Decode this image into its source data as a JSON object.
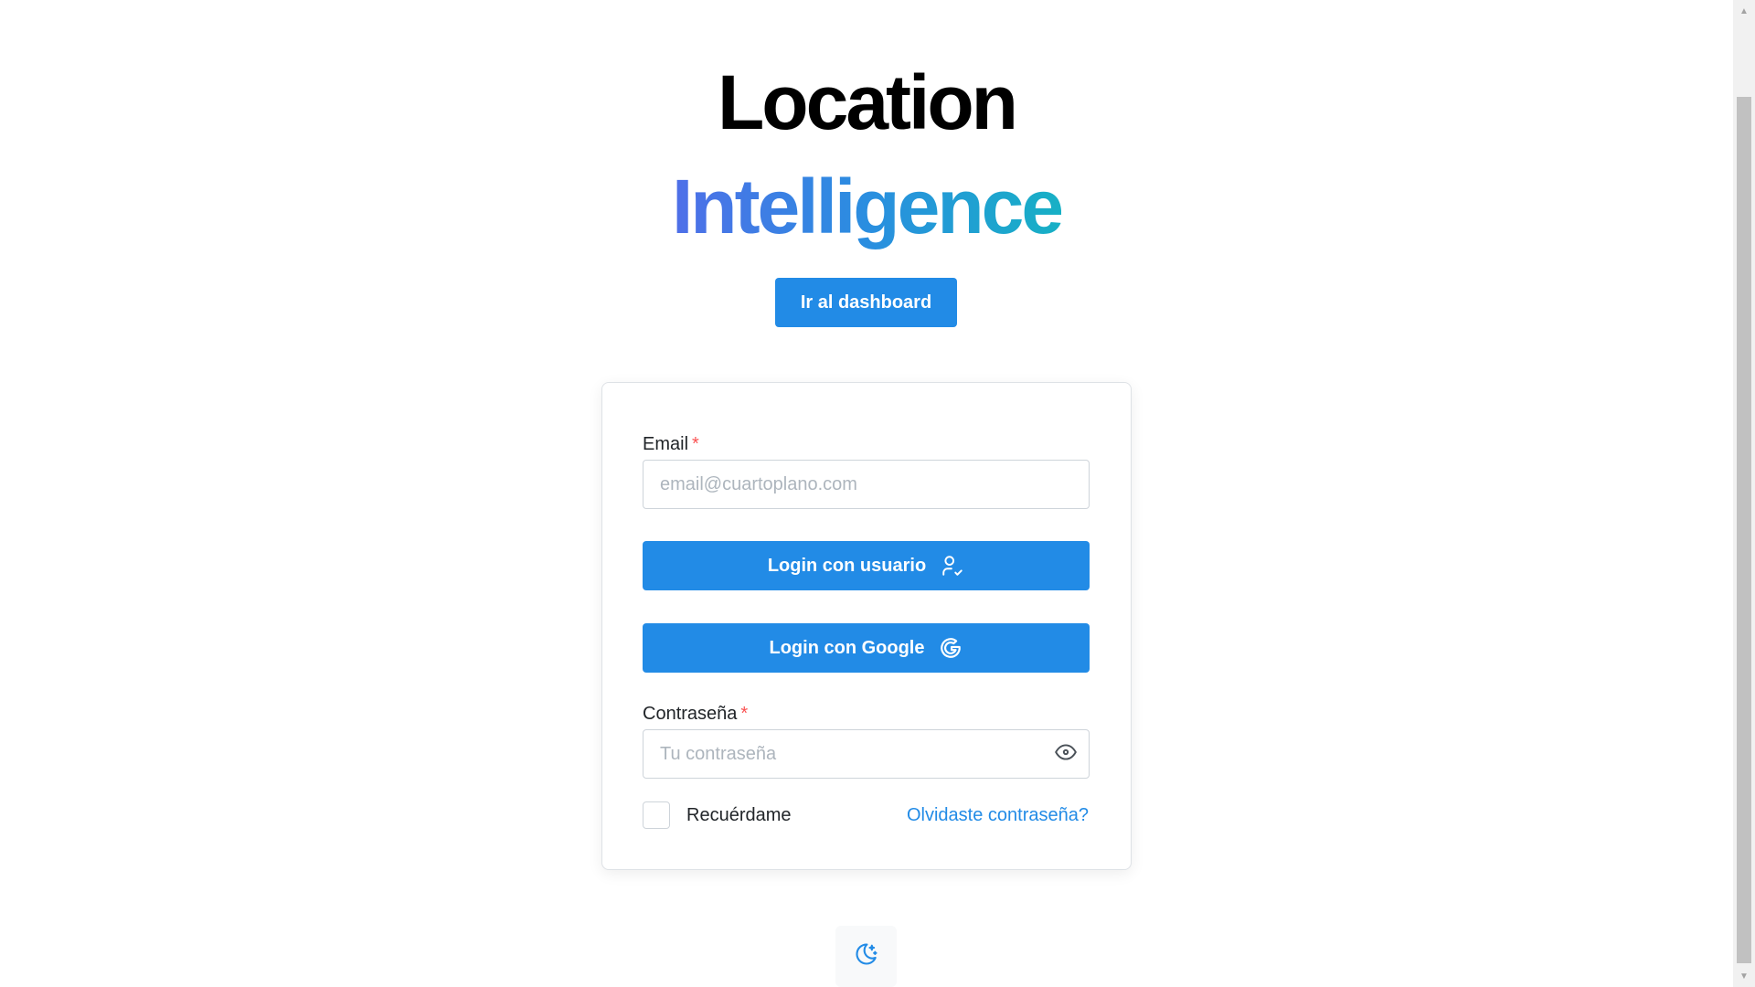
{
  "header": {
    "title_line1": "Location",
    "title_line2": "Intelligence",
    "dashboard_button": "Ir al dashboard"
  },
  "form": {
    "email_label": "Email",
    "required_mark": "*",
    "email_placeholder": "email@cuartoplano.com",
    "email_value": "",
    "login_user_button": "Login con usuario",
    "login_user_icon": "user-check-icon",
    "login_google_button": "Login con Google",
    "login_google_icon": "google-icon",
    "password_label": "Contraseña",
    "password_placeholder": "Tu contraseña",
    "password_value": "",
    "password_toggle_icon": "eye-icon",
    "remember_label": "Recuérdame",
    "remember_checked": false,
    "forgot_link": "Olvidaste contraseña?"
  },
  "footer": {
    "theme_toggle_icon": "moon-stars-icon"
  },
  "colors": {
    "primary": "#228be6",
    "required": "#fa5252",
    "title_gradient_start": "#4f6fe8",
    "title_gradient_end": "#17b0c5"
  }
}
